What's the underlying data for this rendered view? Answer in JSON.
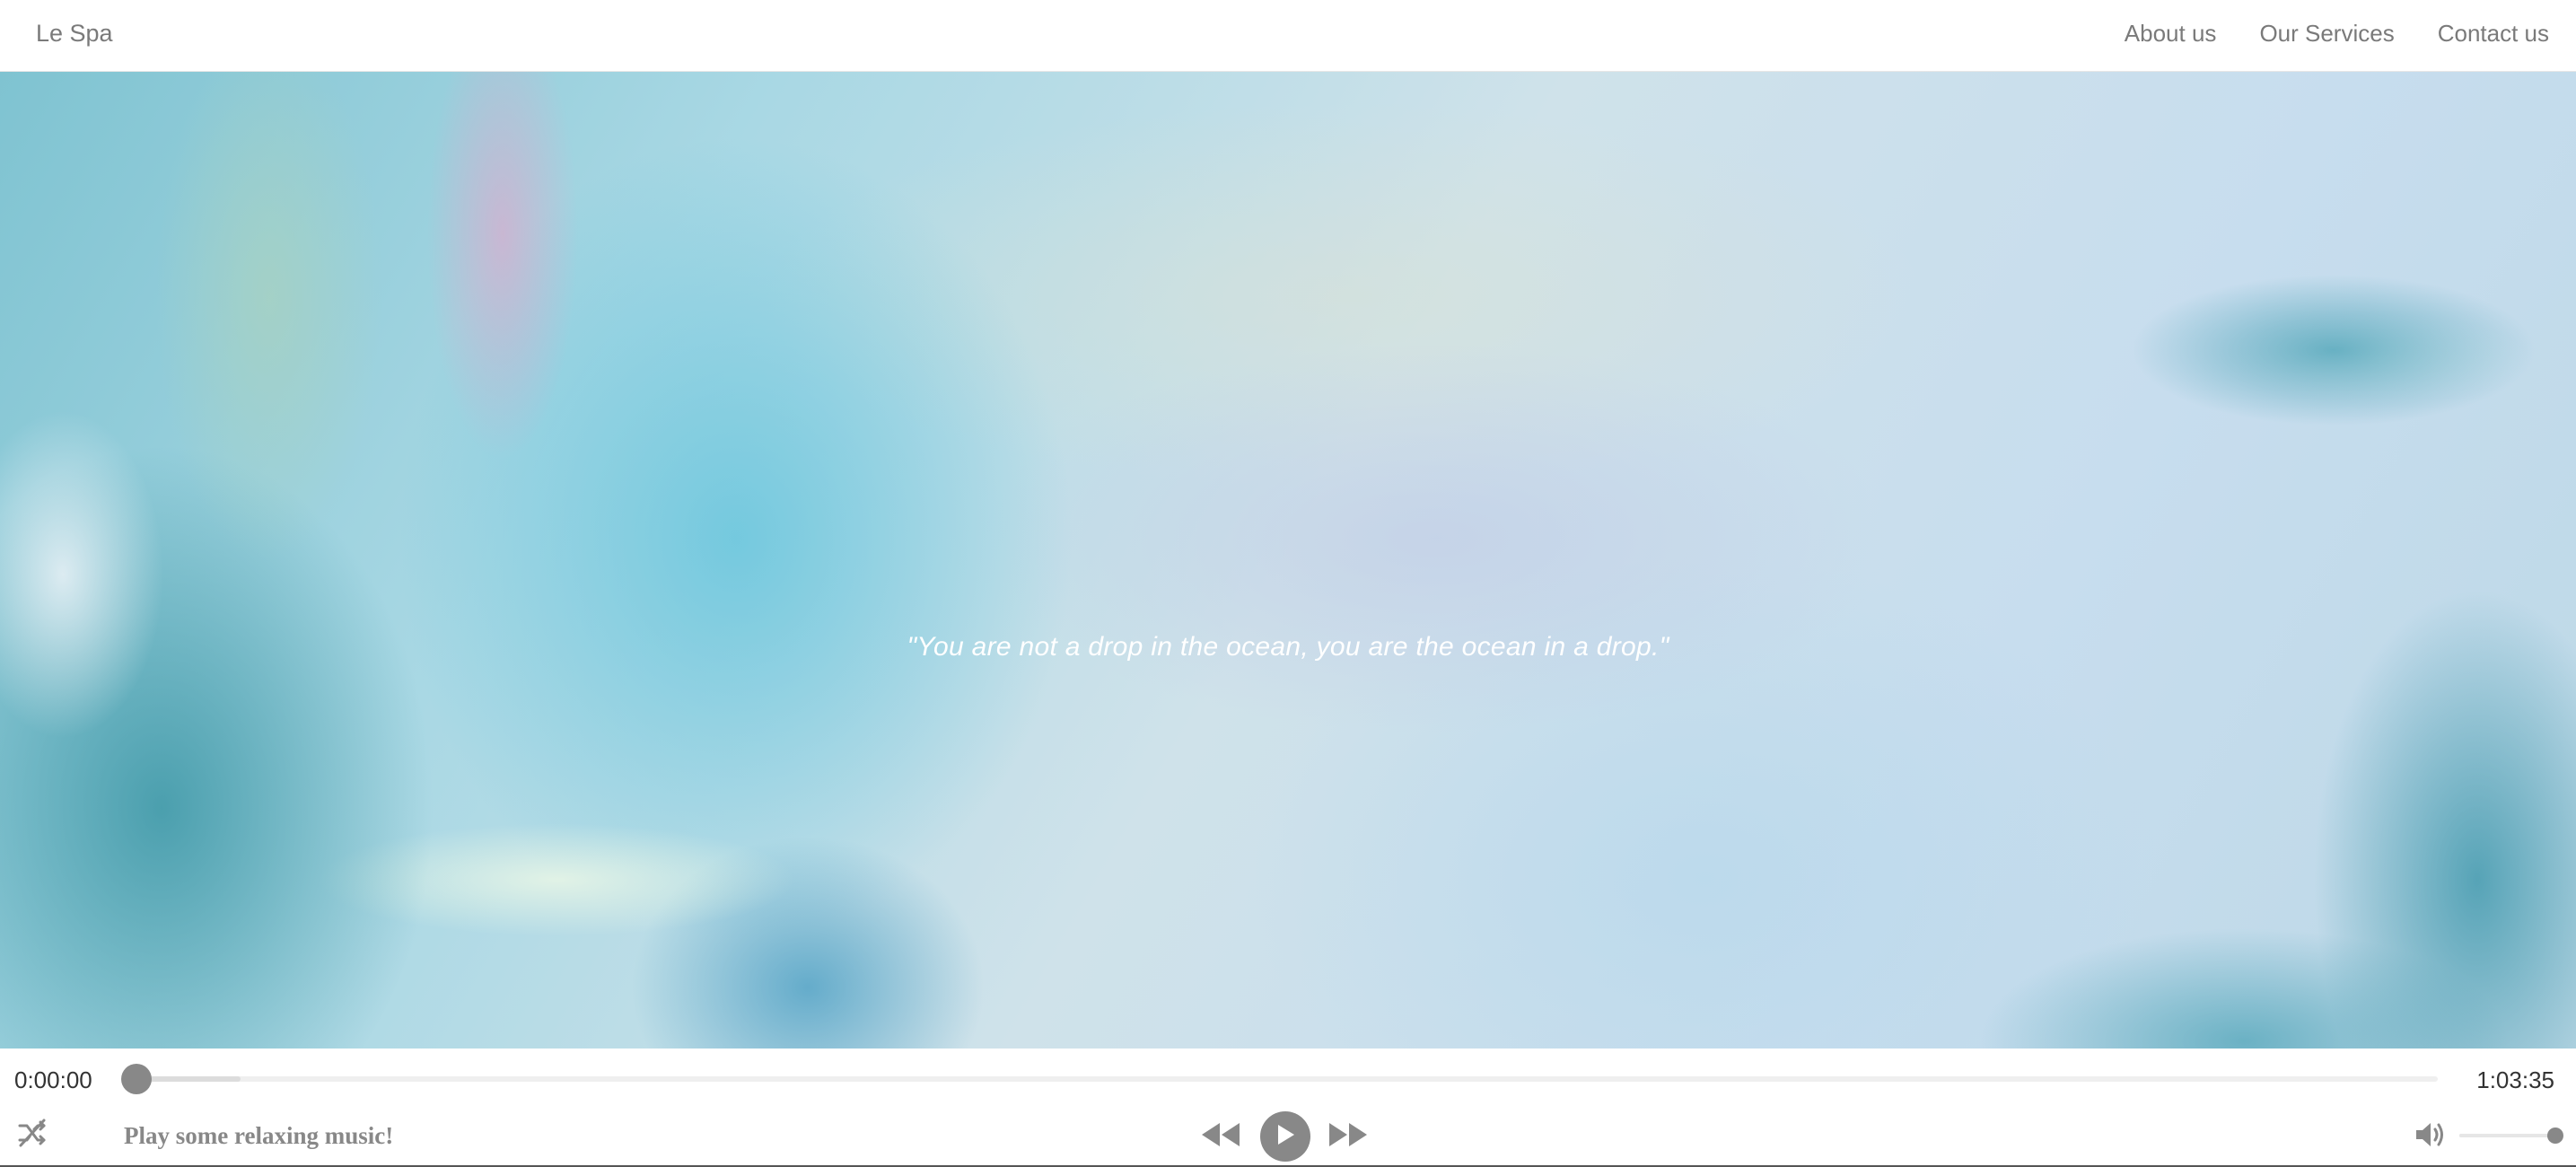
{
  "nav": {
    "brand": "Le Spa",
    "links": [
      {
        "label": "About us"
      },
      {
        "label": "Our Services"
      },
      {
        "label": "Contact us"
      }
    ]
  },
  "hero": {
    "quote": "\"You are not a drop in the ocean, you are the ocean in a drop.\""
  },
  "player": {
    "current_time": "0:00:00",
    "total_time": "1:03:35",
    "title": "Play some relaxing music!",
    "progress": 0,
    "buffered": 0.046,
    "volume": 1.0,
    "icons": {
      "shuffle": "shuffle-off-icon",
      "rewind": "rewind-icon",
      "play": "play-icon",
      "forward": "fast-forward-icon",
      "volume": "volume-icon"
    },
    "accent_color": "#888888"
  }
}
